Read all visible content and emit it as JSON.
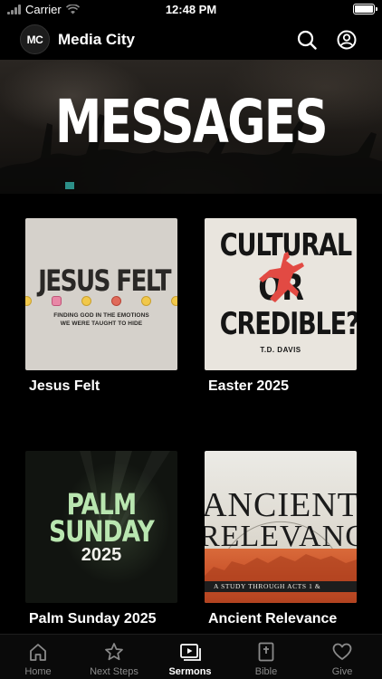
{
  "status_bar": {
    "carrier": "Carrier",
    "time": "12:48 PM",
    "battery_level": 1.0
  },
  "header": {
    "logo_text": "MC",
    "title": "Media City",
    "icons": [
      "search-icon",
      "profile-icon"
    ]
  },
  "hero": {
    "title": "MESSAGES"
  },
  "series": [
    {
      "label": "Jesus Felt",
      "art": {
        "headline": "JESUS FELT",
        "subtitle_line1": "FINDING GOD IN THE EMOTIONS",
        "subtitle_line2": "WE WERE TAUGHT TO HIDE"
      }
    },
    {
      "label": "Easter 2025",
      "art": {
        "line1": "CULTURAL",
        "line2": "OR",
        "line3": "CREDIBLE?",
        "author": "T.D. DAVIS"
      }
    },
    {
      "label": "Palm Sunday 2025",
      "art": {
        "line1": "PALM",
        "line2": "SUNDAY",
        "year": "2025"
      }
    },
    {
      "label": "Ancient Relevance",
      "art": {
        "line1": "ANCIENT",
        "line2": "RELEVANCE",
        "strip": "A STUDY THROUGH ACTS 1 &"
      }
    }
  ],
  "tabs": [
    {
      "label": "Home",
      "icon": "home-icon",
      "active": false
    },
    {
      "label": "Next Steps",
      "icon": "star-icon",
      "active": false
    },
    {
      "label": "Sermons",
      "icon": "sermons-icon",
      "active": true
    },
    {
      "label": "Bible",
      "icon": "bible-icon",
      "active": false
    },
    {
      "label": "Give",
      "icon": "heart-icon",
      "active": false
    }
  ],
  "colors": {
    "background": "#000000",
    "active_tab": "#ffffff",
    "inactive_tab": "#8a8a8a",
    "palm_green": "#b9e6b0",
    "ancient_orange": "#d96a3a"
  }
}
